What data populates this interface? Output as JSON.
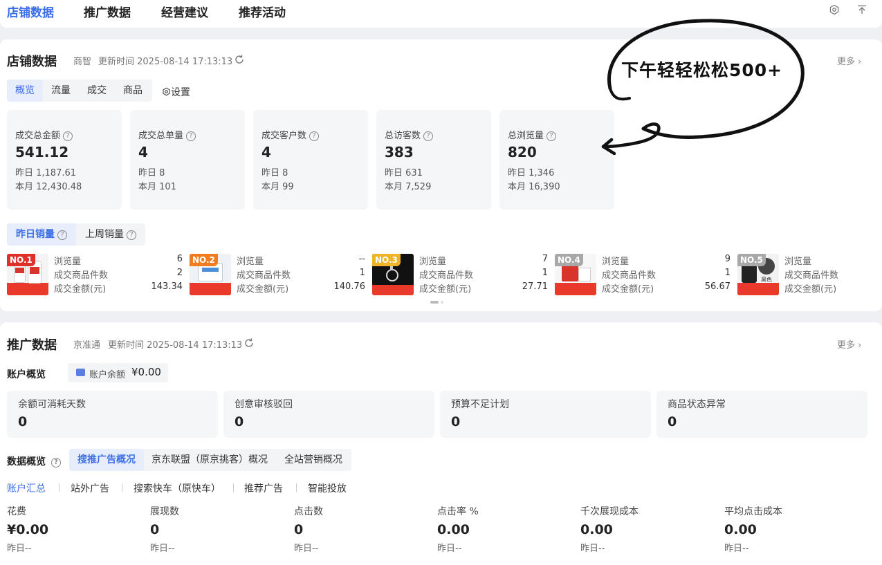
{
  "topnav": {
    "tabs": [
      "店铺数据",
      "推广数据",
      "经营建议",
      "推荐活动"
    ]
  },
  "store": {
    "title": "店铺数据",
    "source": "商智",
    "update_time": "更新时间 2025-08-14 17:13:13",
    "more": "更多",
    "tabs": [
      "概览",
      "流量",
      "成交",
      "商品"
    ],
    "settings": "设置",
    "metrics": [
      {
        "label": "成交总金额",
        "value": "541.12",
        "yesterday": "昨日 1,187.61",
        "month": "本月 12,430.48"
      },
      {
        "label": "成交总单量",
        "value": "4",
        "yesterday": "昨日 8",
        "month": "本月 101"
      },
      {
        "label": "成交客户数",
        "value": "4",
        "yesterday": "昨日 8",
        "month": "本月 99"
      },
      {
        "label": "总访客数",
        "value": "383",
        "yesterday": "昨日 631",
        "month": "本月 7,529"
      },
      {
        "label": "总浏览量",
        "value": "820",
        "yesterday": "昨日 1,346",
        "month": "本月 16,390"
      }
    ],
    "sales_tabs": [
      "昨日销量",
      "上周销量"
    ],
    "products": [
      {
        "rank": "NO.1",
        "rank_color": "#e0302a",
        "views_label": "浏览量",
        "views": "6",
        "items_label": "成交商品件数",
        "items": "2",
        "amount_label": "成交金额(元)",
        "amount": "143.34"
      },
      {
        "rank": "NO.2",
        "rank_color": "#f07c1e",
        "views_label": "浏览量",
        "views": "--",
        "items_label": "成交商品件数",
        "items": "1",
        "amount_label": "成交金额(元)",
        "amount": "140.76"
      },
      {
        "rank": "NO.3",
        "rank_color": "#f0b429",
        "views_label": "浏览量",
        "views": "7",
        "items_label": "成交商品件数",
        "items": "1",
        "amount_label": "成交金额(元)",
        "amount": "27.71"
      },
      {
        "rank": "NO.4",
        "rank_color": "#a8a8a8",
        "views_label": "浏览量",
        "views": "9",
        "items_label": "成交商品件数",
        "items": "1",
        "amount_label": "成交金额(元)",
        "amount": "56.67"
      },
      {
        "rank": "NO.5",
        "rank_color": "#a8a8a8",
        "views_label": "浏览量",
        "items_label": "成交商品件数",
        "amount_label": "成交金额(元)"
      }
    ],
    "thumb_caption": "黑色"
  },
  "annotation": {
    "text": "下午轻轻松松500+"
  },
  "promo": {
    "title": "推广数据",
    "source": "京准通",
    "update_time": "更新时间 2025-08-14 17:13:13",
    "more": "更多",
    "account_label": "账户概览",
    "balance_label": "账户余额",
    "balance_value": "¥0.00",
    "boxes": [
      {
        "label": "余额可消耗天数",
        "value": "0"
      },
      {
        "label": "创意审核驳回",
        "value": "0"
      },
      {
        "label": "预算不足计划",
        "value": "0"
      },
      {
        "label": "商品状态异常",
        "value": "0"
      }
    ],
    "data_label": "数据概览",
    "data_tabs": [
      "搜推广告概况",
      "京东联盟（原京挑客）概况",
      "全站营销概况"
    ],
    "filters": [
      "账户汇总",
      "站外广告",
      "搜索快车（原快车）",
      "推荐广告",
      "智能投放"
    ],
    "stats": [
      {
        "label": "花费",
        "value": "¥0.00",
        "sub": "昨日--"
      },
      {
        "label": "展现数",
        "value": "0",
        "sub": "昨日--"
      },
      {
        "label": "点击数",
        "value": "0",
        "sub": "昨日--"
      },
      {
        "label": "点击率 %",
        "value": "0.00",
        "sub": "昨日--"
      },
      {
        "label": "千次展现成本",
        "value": "0.00",
        "sub": "昨日--"
      },
      {
        "label": "平均点击成本",
        "value": "0.00",
        "sub": "昨日--"
      }
    ]
  },
  "colors": {
    "accent": "#3a6ee8",
    "bg": "#eef0f4"
  }
}
